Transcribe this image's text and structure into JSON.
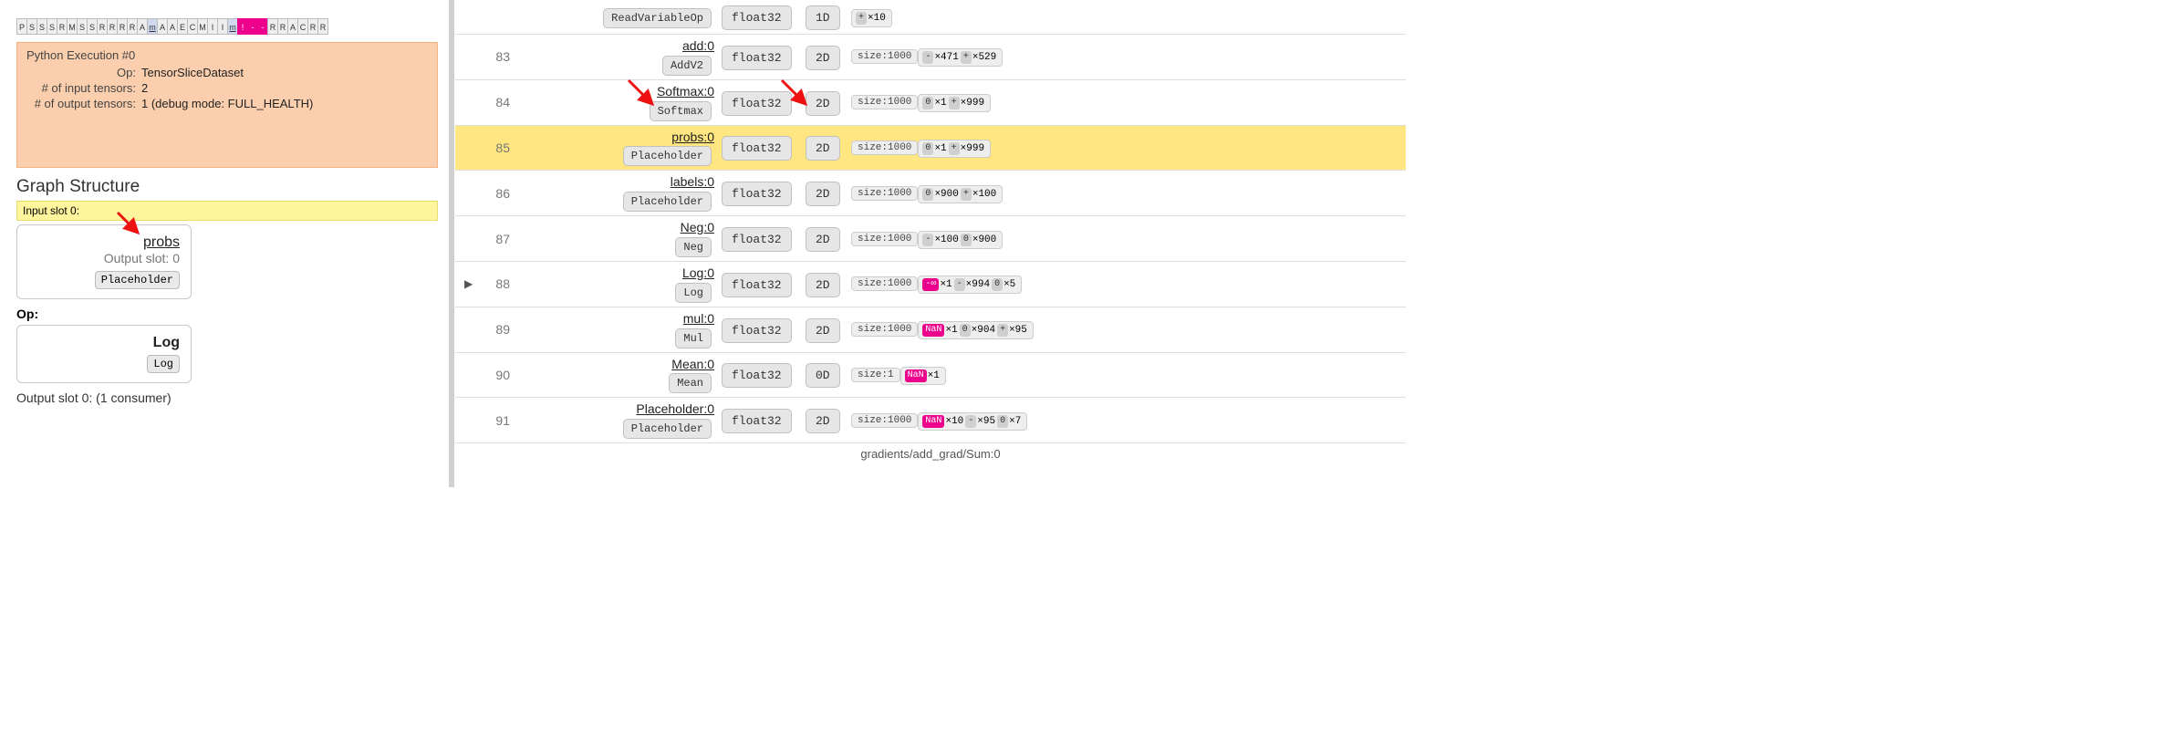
{
  "ribbon": [
    "P",
    "S",
    "S",
    "S",
    "R",
    "M",
    "S",
    "S",
    "R",
    "R",
    "R",
    "R",
    "A",
    "m",
    "A",
    "A",
    "E",
    "C",
    "M",
    "I",
    "I",
    "m",
    "!",
    "-",
    "-",
    "R",
    "R",
    "A",
    "C",
    "R",
    "R"
  ],
  "ribbon_special": {
    "13": "m",
    "21": "m",
    "22": "pinkbang",
    "23": "pink",
    "24": "pink"
  },
  "orange_card": {
    "title": "Python Execution #0",
    "rows": [
      {
        "label": "Op:",
        "value": "TensorSliceDataset"
      },
      {
        "label": "# of input tensors:",
        "value": "2"
      },
      {
        "label": "# of output tensors:",
        "value": "1   (debug mode: FULL_HEALTH)"
      }
    ]
  },
  "graph_heading": "Graph Structure",
  "input_slot_label": "Input slot 0:",
  "input_box": {
    "link": "probs",
    "sub": "Output slot: 0",
    "chip": "Placeholder"
  },
  "op_label": "Op:",
  "op_box": {
    "link": "Log",
    "chip": "Log"
  },
  "output_line": "Output slot 0: (1 consumer)",
  "rows": [
    {
      "idx": "",
      "expand": "",
      "name": "",
      "op": "ReadVariableOp",
      "dtype": "float32",
      "dim": "1D",
      "size": "",
      "stats": [
        {
          "sym": "+",
          "cls": "pos",
          "val": "×10"
        }
      ]
    },
    {
      "idx": "83",
      "expand": "",
      "name": "add:0",
      "op": "AddV2",
      "dtype": "float32",
      "dim": "2D",
      "size": "size:1000",
      "stats": [
        {
          "sym": "-",
          "cls": "neg",
          "val": "×471"
        },
        {
          "sym": "+",
          "cls": "pos",
          "val": "×529"
        }
      ]
    },
    {
      "idx": "84",
      "expand": "",
      "name": "Softmax:0",
      "op": "Softmax",
      "dtype": "float32",
      "dim": "2D",
      "size": "size:1000",
      "stats": [
        {
          "sym": "0",
          "cls": "zero",
          "val": "×1"
        },
        {
          "sym": "+",
          "cls": "pos",
          "val": "×999"
        }
      ]
    },
    {
      "idx": "85",
      "expand": "",
      "name": "probs:0",
      "op": "Placeholder",
      "dtype": "float32",
      "dim": "2D",
      "size": "size:1000",
      "highlight": true,
      "stats": [
        {
          "sym": "0",
          "cls": "zero",
          "val": "×1"
        },
        {
          "sym": "+",
          "cls": "pos",
          "val": "×999"
        }
      ]
    },
    {
      "idx": "86",
      "expand": "",
      "name": "labels:0",
      "op": "Placeholder",
      "dtype": "float32",
      "dim": "2D",
      "size": "size:1000",
      "stats": [
        {
          "sym": "0",
          "cls": "zero",
          "val": "×900"
        },
        {
          "sym": "+",
          "cls": "pos",
          "val": "×100"
        }
      ]
    },
    {
      "idx": "87",
      "expand": "",
      "name": "Neg:0",
      "op": "Neg",
      "dtype": "float32",
      "dim": "2D",
      "size": "size:1000",
      "stats": [
        {
          "sym": "-",
          "cls": "neg",
          "val": "×100"
        },
        {
          "sym": "0",
          "cls": "zero",
          "val": "×900"
        }
      ]
    },
    {
      "idx": "88",
      "expand": "▶",
      "name": "Log:0",
      "op": "Log",
      "dtype": "float32",
      "dim": "2D",
      "size": "size:1000",
      "stats": [
        {
          "sym": "-∞",
          "cls": "ninf",
          "val": "×1"
        },
        {
          "sym": "-",
          "cls": "neg",
          "val": "×994"
        },
        {
          "sym": "0",
          "cls": "zero",
          "val": "×5"
        }
      ]
    },
    {
      "idx": "89",
      "expand": "",
      "name": "mul:0",
      "op": "Mul",
      "dtype": "float32",
      "dim": "2D",
      "size": "size:1000",
      "stats": [
        {
          "sym": "NaN",
          "cls": "nan",
          "val": "×1"
        },
        {
          "sym": "0",
          "cls": "zero",
          "val": "×904"
        },
        {
          "sym": "+",
          "cls": "pos",
          "val": "×95"
        }
      ]
    },
    {
      "idx": "90",
      "expand": "",
      "name": "Mean:0",
      "op": "Mean",
      "dtype": "float32",
      "dim": "0D",
      "size": "size:1",
      "stats": [
        {
          "sym": "NaN",
          "cls": "nan",
          "val": "×1"
        }
      ]
    },
    {
      "idx": "91",
      "expand": "",
      "name": "Placeholder:0",
      "op": "Placeholder",
      "dtype": "float32",
      "dim": "2D",
      "size": "size:1000",
      "stats": [
        {
          "sym": "NaN",
          "cls": "nan",
          "val": "×10"
        },
        {
          "sym": "-",
          "cls": "neg",
          "val": "×95"
        },
        {
          "sym": "0",
          "cls": "zero",
          "val": "×7"
        }
      ]
    }
  ],
  "bottom_partial": "gradients/add_grad/Sum:0"
}
